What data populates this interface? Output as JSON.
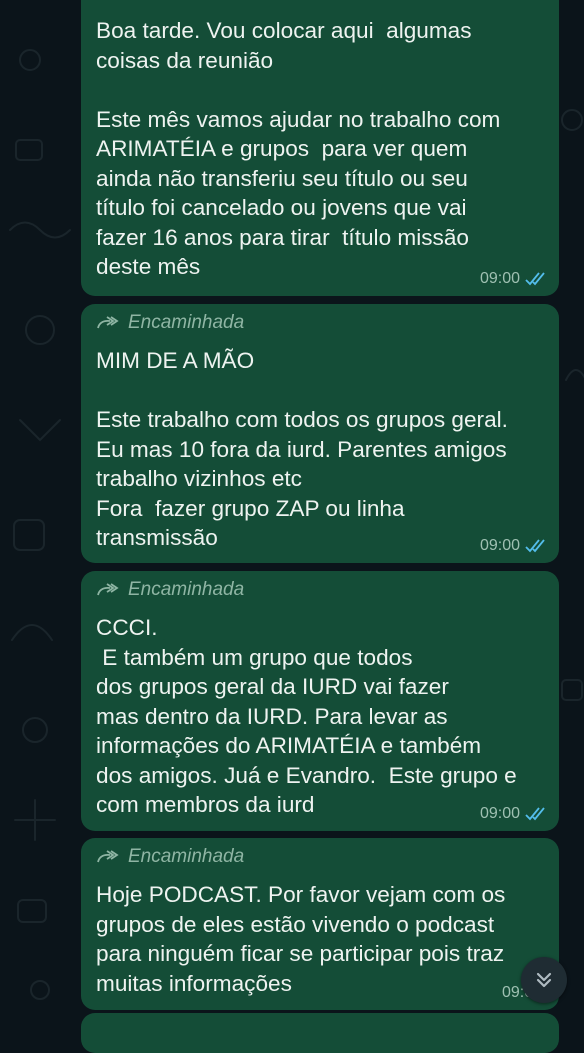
{
  "chat": {
    "messages": [
      {
        "forwarded": false,
        "text": "Boa tarde. Vou colocar aqui  algumas\ncoisas da reunião\n\nEste mês vamos ajudar no trabalho com\nARIMATÉIA e grupos  para ver quem\nainda não transferiu seu título ou seu\ntítulo foi cancelado ou jovens que vai\nfazer 16 anos para tirar  título missão\ndeste mês",
        "time": "09:00",
        "status_icon": "double-check-read-icon"
      },
      {
        "forwarded": true,
        "forwarded_label": "Encaminhada",
        "text": "MIM DE A MÃO\n\nEste trabalho com todos os grupos geral.\nEu mas 10 fora da iurd. Parentes amigos\ntrabalho vizinhos etc\nFora  fazer grupo ZAP ou linha\ntransmissão",
        "time": "09:00",
        "status_icon": "double-check-read-icon"
      },
      {
        "forwarded": true,
        "forwarded_label": "Encaminhada",
        "text": "CCCI.\n E também um grupo que todos\ndos grupos geral da IURD vai fazer\nmas dentro da IURD. Para levar as\ninformações do ARIMATÉIA e também\ndos amigos. Juá e Evandro.  Este grupo e\ncom membros da iurd",
        "time": "09:00",
        "status_icon": "double-check-read-icon"
      },
      {
        "forwarded": true,
        "forwarded_label": "Encaminhada",
        "text": "Hoje PODCAST. Por favor vejam com os\ngrupos de eles estão vivendo o podcast\npara ninguém ficar se participar pois traz\nmuitas informações",
        "time": "09:00",
        "status_icon": "double-check-read-icon"
      }
    ]
  },
  "colors": {
    "background": "#0b141a",
    "outgoing_bubble": "#144d37",
    "read_ticks": "#53bdeb"
  },
  "scroll_button": {
    "icon": "chevrons-down-icon"
  }
}
